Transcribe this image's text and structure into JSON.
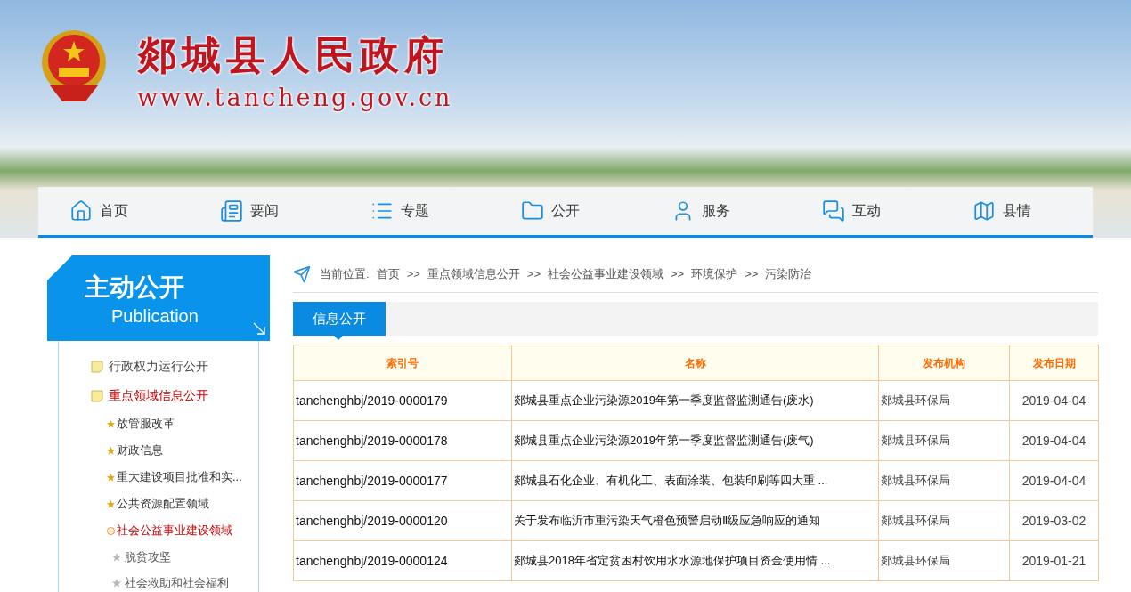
{
  "header": {
    "site_title": "郯城县人民政府",
    "site_url": "www.tancheng.gov.cn"
  },
  "nav": [
    {
      "label": "首页",
      "kind": "home"
    },
    {
      "label": "要闻",
      "kind": "news"
    },
    {
      "label": "专题",
      "kind": "topics"
    },
    {
      "label": "公开",
      "kind": "folder"
    },
    {
      "label": "服务",
      "kind": "user"
    },
    {
      "label": "互动",
      "kind": "chat"
    },
    {
      "label": "县情",
      "kind": "map"
    }
  ],
  "sidebar": {
    "title": "主动公开",
    "subtitle": "Publication",
    "items": [
      {
        "label": "行政权力运行公开",
        "selected": false
      },
      {
        "label": "重点领域信息公开",
        "selected": true,
        "children": [
          {
            "label": "放管服改革",
            "selected": false
          },
          {
            "label": "财政信息",
            "selected": false
          },
          {
            "label": "重大建设项目批准和实...",
            "selected": false
          },
          {
            "label": "公共资源配置领域",
            "selected": false
          },
          {
            "label": "社会公益事业建设领域",
            "selected": true,
            "children": [
              {
                "label": "脱贫攻坚",
                "selected": false
              },
              {
                "label": "社会救助和社会福利",
                "selected": false
              }
            ]
          }
        ]
      }
    ]
  },
  "breadcrumb": {
    "prefix": "当前位置:",
    "items": [
      "首页",
      "重点领域信息公开",
      "社会公益事业建设领域",
      "环境保护",
      "污染防治"
    ],
    "separator": ">>"
  },
  "tabs": [
    {
      "label": "信息公开",
      "selected": true
    }
  ],
  "table": {
    "columns": [
      "索引号",
      "名称",
      "发布机构",
      "发布日期"
    ],
    "rows": [
      [
        "tanchenghbj/2019-0000179",
        "郯城县重点企业污染源2019年第一季度监督监测通告(废水)",
        "郯城县环保局",
        "2019-04-04"
      ],
      [
        "tanchenghbj/2019-0000178",
        "郯城县重点企业污染源2019年第一季度监督监测通告(废气)",
        "郯城县环保局",
        "2019-04-04"
      ],
      [
        "tanchenghbj/2019-0000177",
        "郯城县石化企业、有机化工、表面涂装、包装印刷等四大重 ...",
        "郯城县环保局",
        "2019-04-04"
      ],
      [
        "tanchenghbj/2019-0000120",
        "关于发布临沂市重污染天气橙色预警启动Ⅱ级应急响应的通知",
        "郯城县环保局",
        "2019-03-02"
      ],
      [
        "tanchenghbj/2019-0000124",
        "郯城县2018年省定贫困村饮用水水源地保护项目资金使用情 ...",
        "郯城县环保局",
        "2019-01-21"
      ]
    ]
  }
}
